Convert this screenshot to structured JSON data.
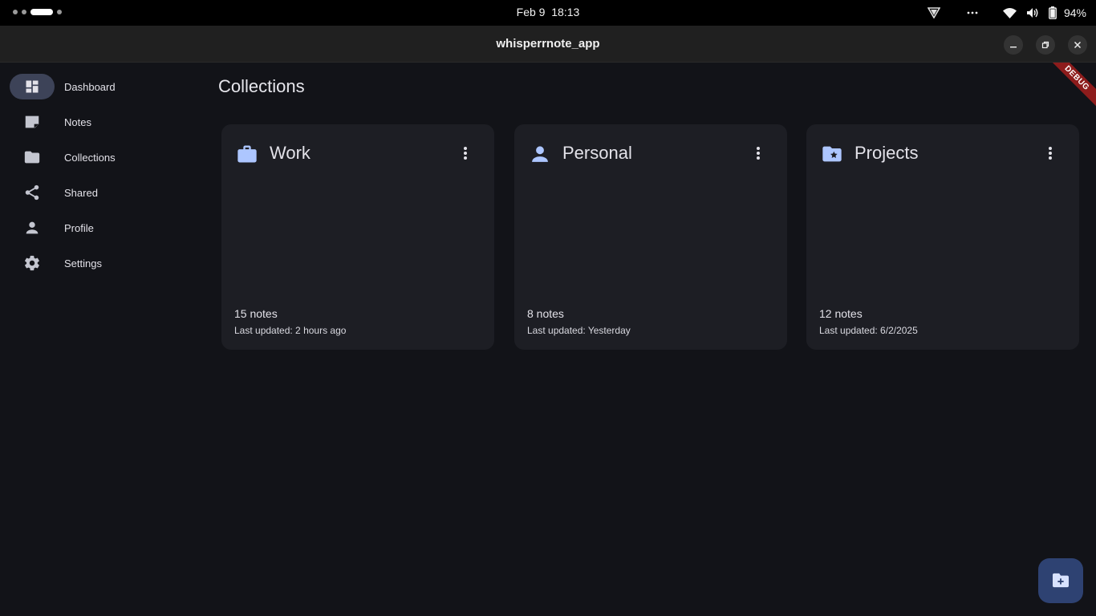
{
  "system": {
    "date": "Feb 9",
    "time": "18:13",
    "battery_percent": "94%",
    "icons": [
      "workspace-indicator",
      "vpn-icon",
      "more-icon",
      "wifi-icon",
      "volume-icon",
      "battery-icon"
    ]
  },
  "window": {
    "title": "whisperrnote_app",
    "controls": [
      "minimize-icon",
      "restore-icon",
      "close-icon"
    ]
  },
  "nav": {
    "items": [
      {
        "label": "Dashboard",
        "icon": "dashboard-icon",
        "active": true
      },
      {
        "label": "Notes",
        "icon": "note-icon",
        "active": false
      },
      {
        "label": "Collections",
        "icon": "folder-icon",
        "active": false
      },
      {
        "label": "Shared",
        "icon": "share-icon",
        "active": false
      },
      {
        "label": "Profile",
        "icon": "person-icon",
        "active": false
      },
      {
        "label": "Settings",
        "icon": "gear-icon",
        "active": false
      }
    ]
  },
  "main": {
    "title": "Collections",
    "debug_label": "DEBUG",
    "collections": [
      {
        "name": "Work",
        "icon": "briefcase-icon",
        "count": "15 notes",
        "updated": "Last updated: 2 hours ago"
      },
      {
        "name": "Personal",
        "icon": "person-icon",
        "count": "8 notes",
        "updated": "Last updated: Yesterday"
      },
      {
        "name": "Projects",
        "icon": "folder-star-icon",
        "count": "12 notes",
        "updated": "Last updated: 6/2/2025"
      }
    ],
    "fab_icon": "create-folder-icon"
  },
  "colors": {
    "background": "#121318",
    "card": "#1d1e24",
    "accent": "#adc6ff",
    "nav_indicator": "#3d4358",
    "fab": "#2e4272",
    "debug_ribbon": "#8d1c1c"
  }
}
